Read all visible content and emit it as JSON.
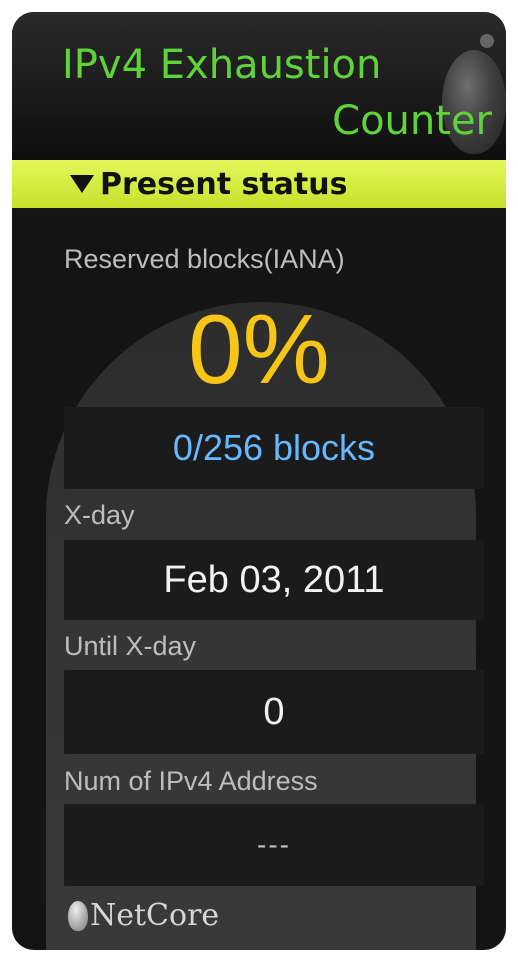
{
  "header": {
    "title_line1": "IPv4 Exhaustion",
    "title_line2": "Counter"
  },
  "status_bar": {
    "label": "Present status"
  },
  "reserved": {
    "label": "Reserved blocks(IANA)",
    "percent": "0%",
    "blocks": "0/256 blocks"
  },
  "xday": {
    "label": "X-day",
    "value": "Feb 03, 2011"
  },
  "until": {
    "label": "Until X-day",
    "value": "0"
  },
  "num_addresses": {
    "label": "Num of IPv4 Address",
    "value": "---"
  },
  "brand": {
    "name": "NetCore"
  },
  "colors": {
    "title_green": "#5fd43a",
    "status_bar": "#d6ec40",
    "percent_yellow": "#f5c518",
    "blocks_blue": "#66b8ff"
  },
  "icons": {
    "header_orb": "globe-orb-icon",
    "close": "close-icon",
    "collapse": "triangle-down-icon",
    "brand": "netcore-logo-icon"
  }
}
